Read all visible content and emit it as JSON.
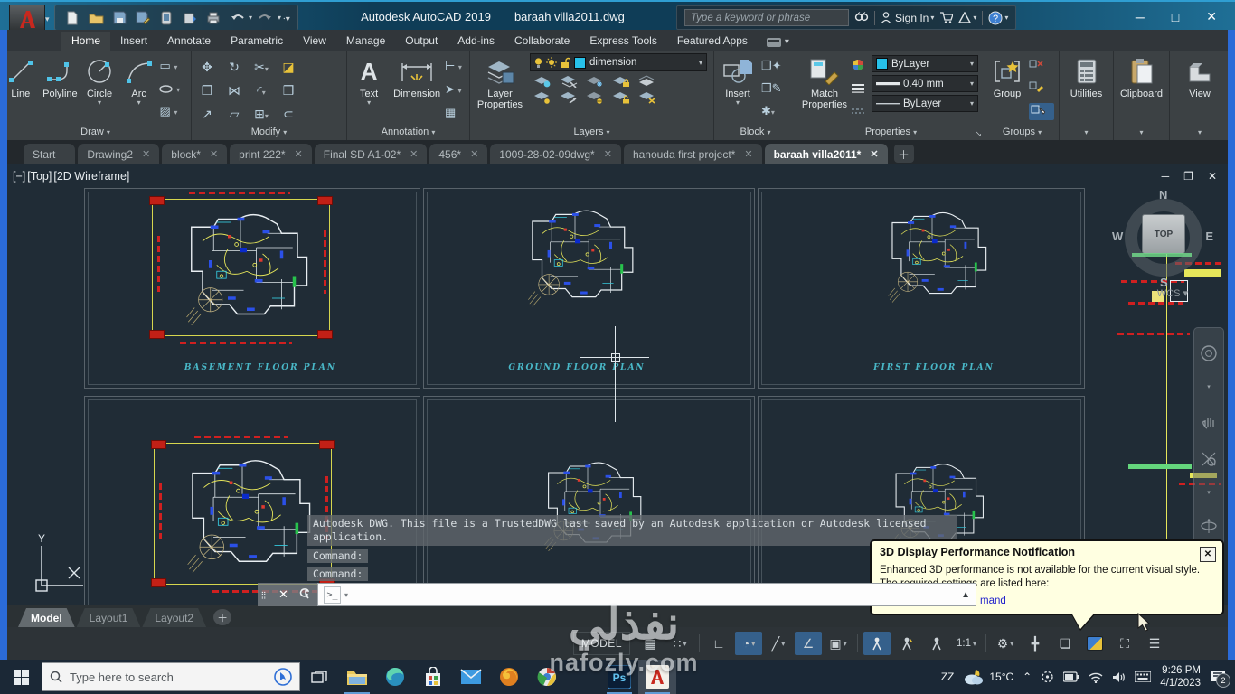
{
  "window": {
    "app_title": "Autodesk AutoCAD 2019",
    "doc_title": "baraah villa2011.dwg"
  },
  "infocenter": {
    "search_placeholder": "Type a keyword or phrase",
    "sign_in_label": "Sign In"
  },
  "ribbon_tabs": {
    "items": [
      "Home",
      "Insert",
      "Annotate",
      "Parametric",
      "View",
      "Manage",
      "Output",
      "Add-ins",
      "Collaborate",
      "Express Tools",
      "Featured Apps"
    ]
  },
  "ribbon": {
    "draw": {
      "title": "Draw",
      "line": "Line",
      "polyline": "Polyline",
      "circle": "Circle",
      "arc": "Arc"
    },
    "modify": {
      "title": "Modify"
    },
    "annotation": {
      "title": "Annotation",
      "text": "Text",
      "dimension": "Dimension"
    },
    "layers": {
      "title": "Layers",
      "layer_properties": "Layer Properties",
      "current_layer": "dimension"
    },
    "block": {
      "title": "Block",
      "insert": "Insert"
    },
    "properties": {
      "title": "Properties",
      "match_properties": "Match Properties",
      "color": "ByLayer",
      "lineweight": "0.40 mm",
      "linetype": "ByLayer"
    },
    "groups": {
      "title": "Groups",
      "group": "Group"
    },
    "utilities": {
      "title": "Utilities"
    },
    "clipboard": {
      "title": "Clipboard"
    },
    "view": {
      "title": "View"
    }
  },
  "doc_tabs": {
    "items": [
      {
        "label": "Start"
      },
      {
        "label": "Drawing2"
      },
      {
        "label": "block*"
      },
      {
        "label": "print 222*"
      },
      {
        "label": "Final SD A1-02*"
      },
      {
        "label": "456*"
      },
      {
        "label": "1009-28-02-09dwg*"
      },
      {
        "label": "hanouda first project*"
      },
      {
        "label": "baraah villa2011*"
      }
    ]
  },
  "viewport": {
    "controls": {
      "minus": "[−]",
      "view": "[Top]",
      "style": "[2D Wireframe]"
    },
    "viewcube": {
      "n": "N",
      "e": "E",
      "s": "S",
      "w": "W",
      "face": "TOP",
      "wcs": "WCS"
    },
    "plan_labels": {
      "p1": "BASEMENT FLOOR PLAN",
      "p2": "GROUND FLOOR PLAN",
      "p3": "FIRST FLOOR PLAN"
    }
  },
  "command_line": {
    "trusted_line1": "Autodesk DWG.  This file is a TrustedDWG last saved by an Autodesk application or Autodesk licensed",
    "trusted_line2": "application.",
    "prompt1": "Command:",
    "prompt2": "Command:"
  },
  "notification": {
    "title": "3D Display Performance Notification",
    "body1": "Enhanced 3D performance is not available for the current visual style.",
    "body2": "The required settings are listed here:",
    "link_visible": "mand"
  },
  "layout_tabs": {
    "model": "Model",
    "layout1": "Layout1",
    "layout2": "Layout2"
  },
  "status_bar": {
    "model": "MODEL",
    "scale": "1:1"
  },
  "taskbar": {
    "search_placeholder": "Type here to search",
    "language": "ZZ",
    "temperature": "15°C",
    "time": "9:26 PM",
    "date": "4/1/2023",
    "notification_count": "2"
  },
  "watermark": {
    "arabic": "نفذلي",
    "latin": "nafozly.com"
  }
}
